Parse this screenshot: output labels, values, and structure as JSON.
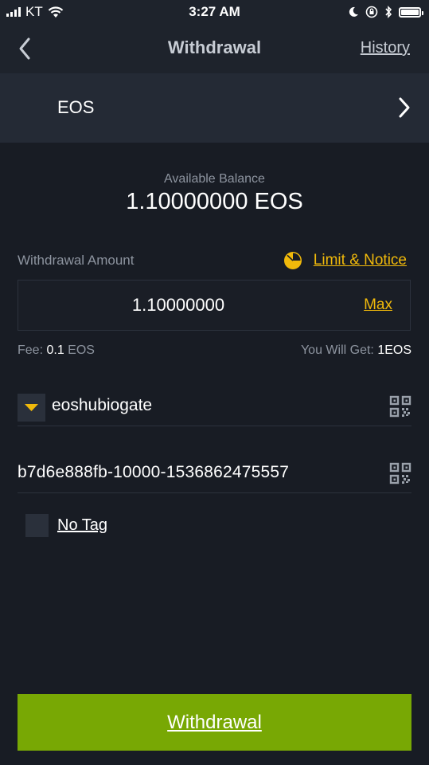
{
  "status_bar": {
    "carrier": "KT",
    "time": "3:27 AM"
  },
  "nav": {
    "title": "Withdrawal",
    "history_label": "History",
    "back_icon": "chevron-left-icon"
  },
  "coin": {
    "name": "EOS",
    "chevron_icon": "chevron-right-icon"
  },
  "balance": {
    "label": "Available Balance",
    "value": "1.10000000 EOS"
  },
  "amount": {
    "label": "Withdrawal Amount",
    "limit_label": "Limit & Notice",
    "value": "1.10000000",
    "max_label": "Max"
  },
  "fee": {
    "label": "Fee: ",
    "value": "0.1",
    "unit": " EOS"
  },
  "receive": {
    "label": "You Will Get: ",
    "value": "1EOS"
  },
  "address": {
    "value": "eoshubiogate"
  },
  "memo": {
    "value": "b7d6e888fb-10000-1536862475557"
  },
  "no_tag": {
    "label": "No Tag",
    "checked": false
  },
  "submit": {
    "label": "Withdrawal"
  },
  "colors": {
    "accent": "#f0b90b",
    "button": "#78a804",
    "background": "#181c24",
    "header": "#1e232c",
    "panel": "#242a35"
  }
}
